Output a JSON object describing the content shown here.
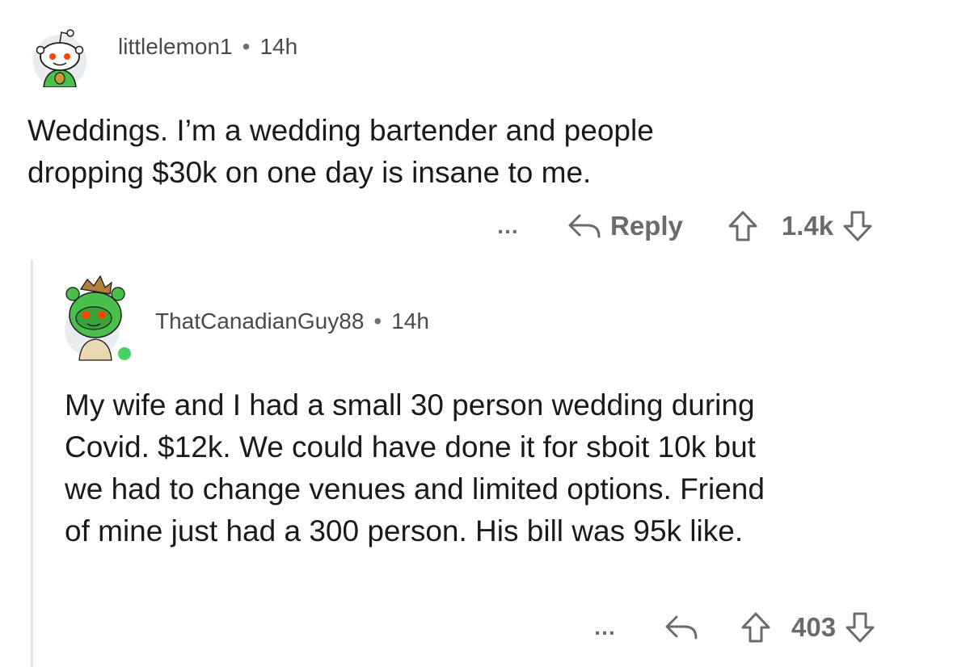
{
  "comments": [
    {
      "username": "littlelemon1",
      "separator": "•",
      "age": "14h",
      "text_lines": [
        "Weddings. I’m a wedding bartender and people",
        "dropping $30k on one day is insane to me."
      ],
      "actions": {
        "more": "…",
        "reply_label": "Reply",
        "score": "1.4k"
      }
    },
    {
      "username": "ThatCanadianGuy88",
      "separator": "•",
      "age": "14h",
      "online": true,
      "text_lines": [
        "My wife and I had a small 30 person wedding during",
        "Covid. $12k. We could have done it for sboit 10k but",
        "we had to change venues and limited options. Friend",
        "of mine just had a 300 person. His bill was 95k like."
      ],
      "actions": {
        "more": "…",
        "score": "403"
      }
    }
  ],
  "colors": {
    "background": "#ffffff",
    "text": "#1a1a1a",
    "meta": "#4a4a4a",
    "action": "#6b6b6b",
    "thread_line": "#e6e6e6",
    "online_dot": "#46d160",
    "snoo_accent": "#ff4500",
    "avatar_green": "#4bbf4b"
  }
}
